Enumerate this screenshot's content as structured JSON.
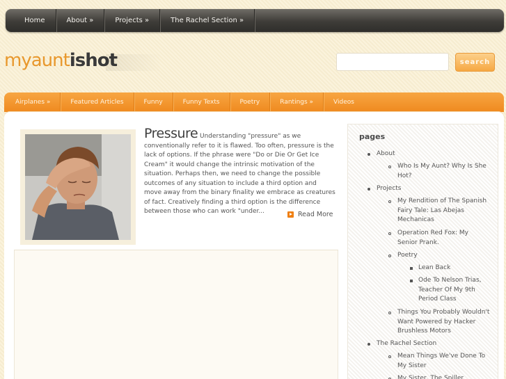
{
  "top_nav": [
    "Home",
    "About »",
    "Projects »",
    "The Rachel Section »"
  ],
  "logo": {
    "part1": "myaunt",
    "part2": "ishot"
  },
  "search": {
    "value": "",
    "button": "search"
  },
  "category_nav": [
    "Airplanes »",
    "Featured Articles",
    "Funny",
    "Funny Texts",
    "Poetry",
    "Rantings »",
    "Videos"
  ],
  "post": {
    "title": "Pressure",
    "excerpt": "Understanding \"pressure\" as we conventionally refer to it is flawed. Too often, pressure is the lack of options. If the phrase were \"Do or Die Or Get Ice Cream\" it would change the intrinsic motivation of the situation. Perhaps then, we need to change the possible outcomes of any situation to include a third option and move away from the binary finality we embrace as creatures of fact. Creatively finding a third option is the difference between those who can work \"under...",
    "read_more": "Read More"
  },
  "sidebar": {
    "heading": "pages",
    "items": [
      {
        "label": "About",
        "level": 1
      },
      {
        "label": "Who Is My Aunt? Why Is She Hot?",
        "level": 2
      },
      {
        "label": "Projects",
        "level": 1
      },
      {
        "label": "My Rendition of The Spanish Fairy Tale: Las Abejas Mechanicas",
        "level": 2
      },
      {
        "label": "Operation Red Fox: My Senior Prank.",
        "level": 2
      },
      {
        "label": "Poetry",
        "level": 2
      },
      {
        "label": "Lean Back",
        "level": 3
      },
      {
        "label": "Ode To Nelson Trias, Teacher Of My 9th Period Class",
        "level": 3
      },
      {
        "label": "Things You Probably Wouldn't Want Powered by Hacker Brushless Motors",
        "level": 2
      },
      {
        "label": "The Rachel Section",
        "level": 1
      },
      {
        "label": "Mean Things We've Done To My Sister",
        "level": 2
      },
      {
        "label": "My Sister, The Spiller",
        "level": 2
      }
    ]
  }
}
